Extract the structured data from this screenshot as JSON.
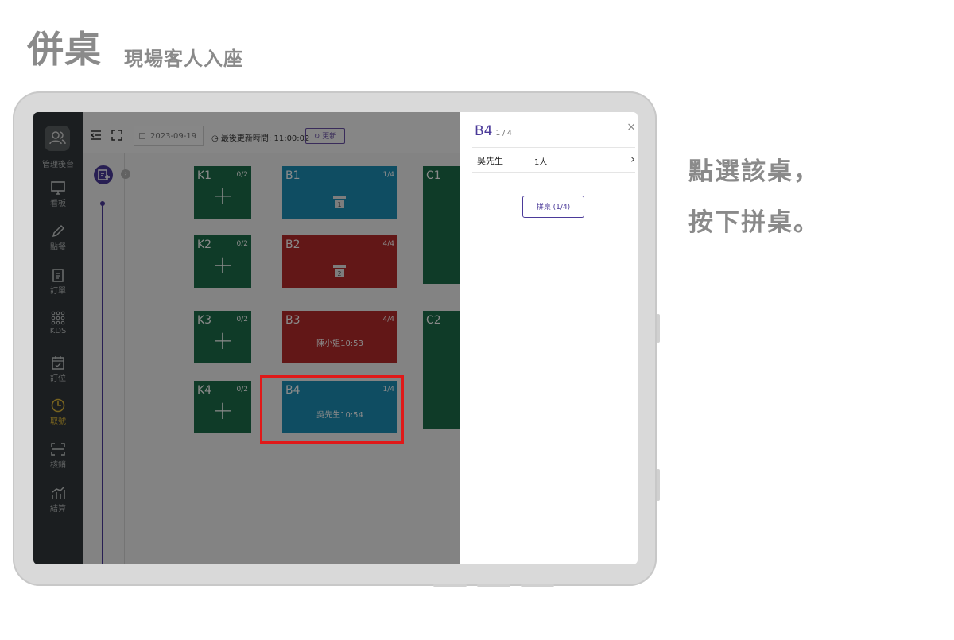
{
  "heading": {
    "title": "併桌",
    "subtitle": "現場客人入座"
  },
  "instruction": {
    "line1": "點選該桌，",
    "line2": "按下拼桌。"
  },
  "sidebar": {
    "avatar_label": "管理後台",
    "items": [
      {
        "label": "看板",
        "icon": "monitor-icon"
      },
      {
        "label": "點餐",
        "icon": "pencil-icon"
      },
      {
        "label": "訂單",
        "icon": "clipboard-icon"
      },
      {
        "label": "KDS",
        "icon": "grid-dots-icon"
      },
      {
        "label": "訂位",
        "icon": "calendar-check-icon"
      },
      {
        "label": "取號",
        "icon": "clock-icon"
      },
      {
        "label": "核銷",
        "icon": "scan-icon"
      },
      {
        "label": "結算",
        "icon": "bar-chart-icon"
      }
    ],
    "active_item": "取號",
    "active_color": "#e0b93a"
  },
  "topbar": {
    "date": "2023-09-19",
    "last_update_label": "最後更新時間:",
    "last_update_time": "11:00:02",
    "refresh_label": "更新"
  },
  "tables": {
    "K1": {
      "name": "K1",
      "count": "0/2",
      "color": "#1d6e4a"
    },
    "K2": {
      "name": "K2",
      "count": "0/2",
      "color": "#1d6e4a"
    },
    "K3": {
      "name": "K3",
      "count": "0/2",
      "color": "#1d6e4a"
    },
    "K4": {
      "name": "K4",
      "count": "0/2",
      "color": "#1d6e4a"
    },
    "B1": {
      "name": "B1",
      "count": "1/4",
      "icon_num": "1",
      "color": "#1c8fb5"
    },
    "B2": {
      "name": "B2",
      "count": "4/4",
      "icon_num": "2",
      "color": "#b52b2b"
    },
    "B3": {
      "name": "B3",
      "count": "4/4",
      "guest": "陳小姐10:53",
      "color": "#b52b2b"
    },
    "B4": {
      "name": "B4",
      "count": "1/4",
      "guest": "吳先生10:54",
      "color": "#1c8fb5"
    },
    "C1": {
      "name": "C1"
    },
    "C2": {
      "name": "C2"
    }
  },
  "panel": {
    "table_name": "B4",
    "table_count": "1 / 4",
    "close": "×",
    "guest_name": "吳先生",
    "guest_people": "1人",
    "merge_button": "拼桌 (1/4)"
  }
}
